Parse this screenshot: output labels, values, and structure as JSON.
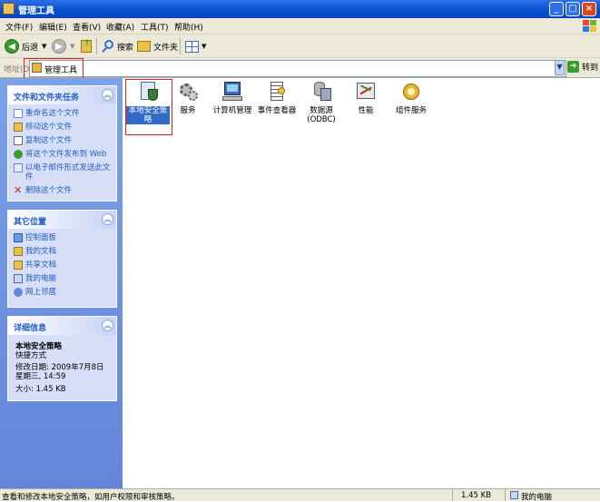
{
  "window": {
    "title": "管理工具"
  },
  "menu": [
    "文件(F)",
    "编辑(E)",
    "查看(V)",
    "收藏(A)",
    "工具(T)",
    "帮助(H)"
  ],
  "toolbar": {
    "back_label": "后退",
    "search_label": "搜索",
    "folders_label": "文件夹"
  },
  "address": {
    "label": "地址(D)",
    "value": "管理工具",
    "go_label": "转到"
  },
  "tasks_panel": {
    "title": "文件和文件夹任务",
    "items": [
      "重命名这个文件",
      "移动这个文件",
      "复制这个文件",
      "将这个文件发布到 Web",
      "以电子邮件形式发送此文件",
      "删除这个文件"
    ]
  },
  "other_places": {
    "title": "其它位置",
    "items": [
      "控制面板",
      "我的文档",
      "共享文档",
      "我的电脑",
      "网上邻居"
    ]
  },
  "details": {
    "title": "详细信息",
    "name": "本地安全策略",
    "type": "快捷方式",
    "modified": "修改日期: 2009年7月8日 星期三, 14:59",
    "size": "大小: 1.45 KB"
  },
  "files": [
    "本地安全策略",
    "服务",
    "计算机管理",
    "事件查看器",
    "数据源 (ODBC)",
    "性能",
    "组件服务"
  ],
  "status": {
    "text": "查看和修改本地安全策略，如用户权限和审核策略。",
    "size": "1.45 KB",
    "location": "我的电脑"
  }
}
